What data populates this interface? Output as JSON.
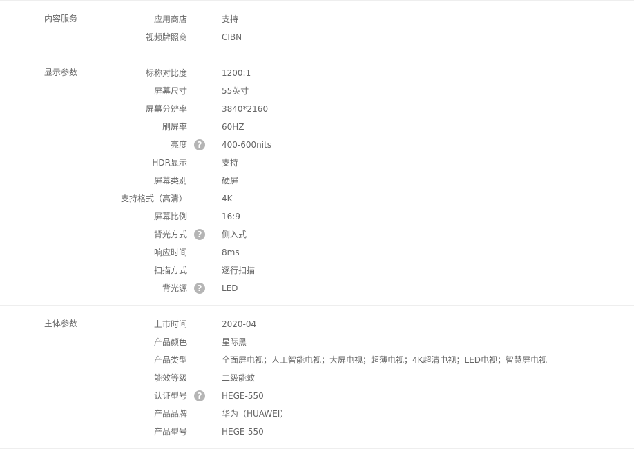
{
  "groups": [
    {
      "title": "内容服务",
      "rows": [
        {
          "name": "应用商店",
          "value": "支持",
          "help": false
        },
        {
          "name": "视频牌照商",
          "value": "CIBN",
          "help": false
        }
      ]
    },
    {
      "title": "显示参数",
      "rows": [
        {
          "name": "标称对比度",
          "value": "1200:1",
          "help": false
        },
        {
          "name": "屏幕尺寸",
          "value": "55英寸",
          "help": false
        },
        {
          "name": "屏幕分辨率",
          "value": "3840*2160",
          "help": false
        },
        {
          "name": "刷屏率",
          "value": "60HZ",
          "help": false
        },
        {
          "name": "亮度",
          "value": "400-600nits",
          "help": true
        },
        {
          "name": "HDR显示",
          "value": "支持",
          "help": false
        },
        {
          "name": "屏幕类别",
          "value": "硬屏",
          "help": false
        },
        {
          "name": "支持格式（高清）",
          "value": "4K",
          "help": false
        },
        {
          "name": "屏幕比例",
          "value": "16:9",
          "help": false
        },
        {
          "name": "背光方式",
          "value": "侧入式",
          "help": true
        },
        {
          "name": "响应时间",
          "value": "8ms",
          "help": false
        },
        {
          "name": "扫描方式",
          "value": "逐行扫描",
          "help": false
        },
        {
          "name": "背光源",
          "value": "LED",
          "help": true
        }
      ]
    },
    {
      "title": "主体参数",
      "rows": [
        {
          "name": "上市时间",
          "value": "2020-04",
          "help": false
        },
        {
          "name": "产品颜色",
          "value": "星际黑",
          "help": false
        },
        {
          "name": "产品类型",
          "value": "全面屏电视；人工智能电视；大屏电视；超薄电视；4K超清电视；LED电视；智慧屏电视",
          "help": false
        },
        {
          "name": "能效等级",
          "value": "二级能效",
          "help": false
        },
        {
          "name": "认证型号",
          "value": "HEGE-550",
          "help": true
        },
        {
          "name": "产品品牌",
          "value": "华为（HUAWEI）",
          "help": false
        },
        {
          "name": "产品型号",
          "value": "HEGE-550",
          "help": false
        }
      ]
    }
  ],
  "help_icon": {
    "name": "question-circle-icon",
    "glyph": "?",
    "color": "#b5b5b5"
  }
}
